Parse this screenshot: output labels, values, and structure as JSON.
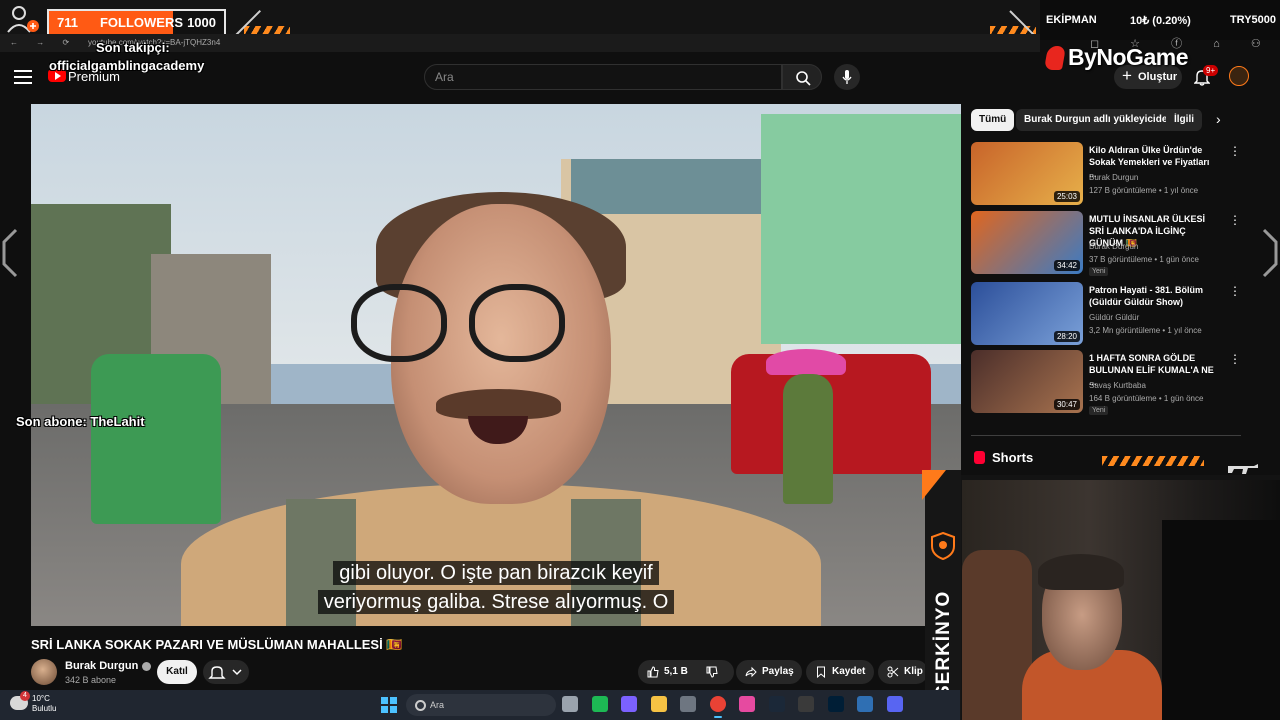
{
  "overlay": {
    "followers": {
      "count": "711",
      "label": "FOLLOWERS",
      "goal": "1000",
      "progress": 0.711
    },
    "last_follower": "Son takipçi:",
    "last_follower_name": "officialgamblingacademy",
    "last_sub": "Son abone: TheLahit",
    "gear_ticker": {
      "label": "EKİPMAN",
      "change": "10₺ (0.20%)",
      "symbol": "TRY5000"
    },
    "brand": "ByNoGame",
    "streamer": "SERKİNYO",
    "accent_color": "#ff7a1a"
  },
  "browser": {
    "nav": "← → ⟳",
    "url": "youtube.com/watch?v=BA-jTQHZ3n4",
    "icons": "◻ ☆ ⓕ ⌂ ⚇ ⋯"
  },
  "header": {
    "logo_text": "Premium",
    "search_placeholder": "Ara",
    "create_label": "Oluştur",
    "notif_badge": "9+"
  },
  "video": {
    "subtitle_line1": "gibi oluyor. O işte pan birazcık keyif",
    "subtitle_line2": "veriyormuş galiba. Strese alıyormuş. O",
    "title": "SRİ LANKA SOKAK PAZARI VE MÜSLÜMAN MAHALLESİ 🇱🇰",
    "channel": "Burak Durgun",
    "subs": "342 B abone",
    "join_label": "Katıl",
    "likes": "5,1 B",
    "share_label": "Paylaş",
    "save_label": "Kaydet",
    "clip_label": "Klip"
  },
  "sidebar": {
    "chips": [
      "Tümü",
      "Burak Durgun adlı yükleyiciden",
      "İlgili"
    ],
    "items": [
      {
        "title": "Kilo Aldıran Ülke Ürdün'de Sokak Yemekleri ve Fiyatları ...",
        "channel": "Burak Durgun",
        "meta": "127 B görüntüleme • 1 yıl önce",
        "duration": "25:03",
        "new": "",
        "thumb_colors": [
          "#c8642a",
          "#e7b04a"
        ]
      },
      {
        "title": "MUTLU İNSANLAR ÜLKESİ SRİ LANKA'DA İLGİNÇ GÜNÜM 🇱🇰",
        "channel": "Burak Durgun",
        "meta": "37 B görüntüleme • 1 gün önce",
        "duration": "34:42",
        "new": "Yeni",
        "thumb_colors": [
          "#e0661f",
          "#3b7bc4"
        ]
      },
      {
        "title": "Patron Hayati - 381. Bölüm (Güldür Güldür Show)",
        "channel": "Güldür Güldür",
        "meta": "3,2 Mn görüntüleme • 1 yıl önce",
        "duration": "28:20",
        "new": "",
        "thumb_colors": [
          "#2c4f9a",
          "#7aa0d8"
        ]
      },
      {
        "title": "1 HAFTA SONRA GÖLDE BULUNAN ELİF KUMAL'A NE ...",
        "channel": "Savaş Kurtbaba",
        "meta": "164 B görüntüleme • 1 gün önce",
        "duration": "30:47",
        "new": "Yeni",
        "thumb_colors": [
          "#4b2e2a",
          "#a8734f"
        ]
      }
    ],
    "shorts_label": "Shorts"
  },
  "taskbar": {
    "temp": "10°C",
    "condition": "Bulutlu",
    "weather_badge": "4",
    "search_placeholder": "Ara",
    "apps": [
      {
        "name": "file-app",
        "color": "#9aa3ad"
      },
      {
        "name": "spotify",
        "color": "#1db954"
      },
      {
        "name": "copilot",
        "color": "#7b61ff"
      },
      {
        "name": "explorer",
        "color": "#f6c244"
      },
      {
        "name": "calculator",
        "color": "#6e7681"
      },
      {
        "name": "chrome",
        "color": "#e94235"
      },
      {
        "name": "photos",
        "color": "#e64aa0"
      },
      {
        "name": "steam",
        "color": "#1b2838"
      },
      {
        "name": "obs",
        "color": "#3a3a3a"
      },
      {
        "name": "photoshop",
        "color": "#001e36"
      },
      {
        "name": "virtualbox",
        "color": "#2f6fb3"
      },
      {
        "name": "discord",
        "color": "#5865f2"
      }
    ]
  }
}
